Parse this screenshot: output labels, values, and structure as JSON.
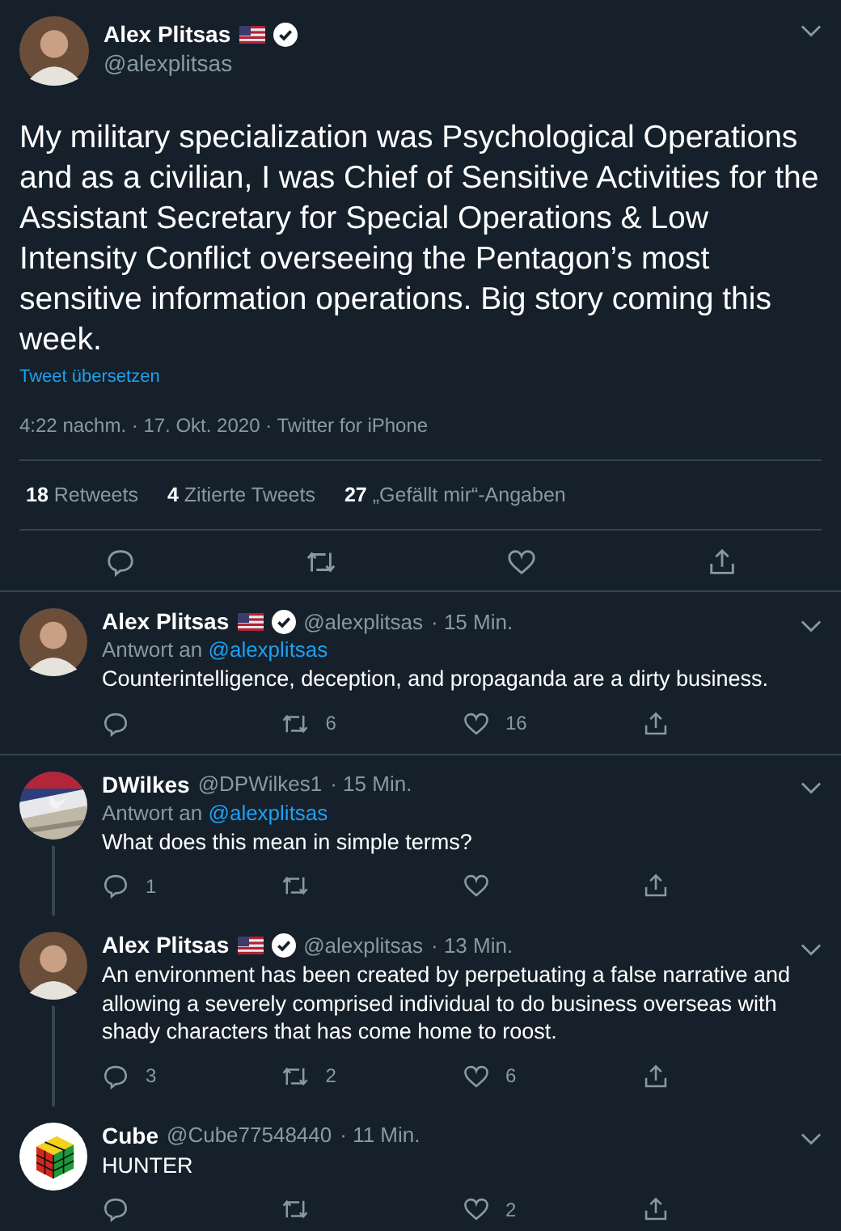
{
  "tweet": {
    "name": "Alex Plitsas",
    "handle": "@alexplitsas",
    "flag": true,
    "verified": true,
    "text": "My military specialization was Psychological Operations and as a civilian, I was Chief of Sensitive Activities for the Assistant Secretary for Special Operations & Low Intensity Conflict overseeing the Pentagon’s most sensitive information operations. Big story coming this week.",
    "translate": "Tweet übersetzen",
    "meta": "4:22 nachm. · 17. Okt. 2020 · Twitter for iPhone",
    "stats": [
      {
        "count": "18",
        "label": "Retweets"
      },
      {
        "count": "4",
        "label": "Zitierte Tweets"
      },
      {
        "count": "27",
        "label": "„Gefällt mir“-Angaben"
      }
    ]
  },
  "replies": [
    {
      "avatar": {
        "kind": "person"
      },
      "name": "Alex Plitsas",
      "flag": true,
      "verified": true,
      "handle": "@alexplitsas",
      "time": "· 15 Min.",
      "reply_prefix": "Antwort an",
      "reply_to": "@alexplitsas",
      "text": "Counterintelligence, deception, and propaganda are a dirty business.",
      "retweets": "6",
      "likes": "16",
      "thread_line": false
    },
    {
      "name": "DWilkes",
      "flag": false,
      "verified": false,
      "handle": "@DPWilkes1",
      "time": "· 15 Min.",
      "reply_prefix": "Antwort an",
      "reply_to": "@alexplitsas",
      "text": "What does this mean in simple terms?",
      "replies": "1",
      "thread_line": true
    },
    {
      "avatar": {
        "kind": "person"
      },
      "name": "Alex Plitsas",
      "flag": true,
      "verified": true,
      "handle": "@alexplitsas",
      "time": "· 13 Min.",
      "text": "An environment has been created by perpetuating a false narrative and allowing a severely comprised individual to do business overseas with shady characters that has come home to roost.",
      "replies": "3",
      "retweets": "2",
      "likes": "6",
      "thread_line": true
    },
    {
      "avatar": {
        "kind": "cube"
      },
      "name": "Cube",
      "flag": false,
      "verified": false,
      "handle": "@Cube77548440",
      "time": "· 11 Min.",
      "text": "HUNTER",
      "likes": "2",
      "thread_line": false
    }
  ]
}
